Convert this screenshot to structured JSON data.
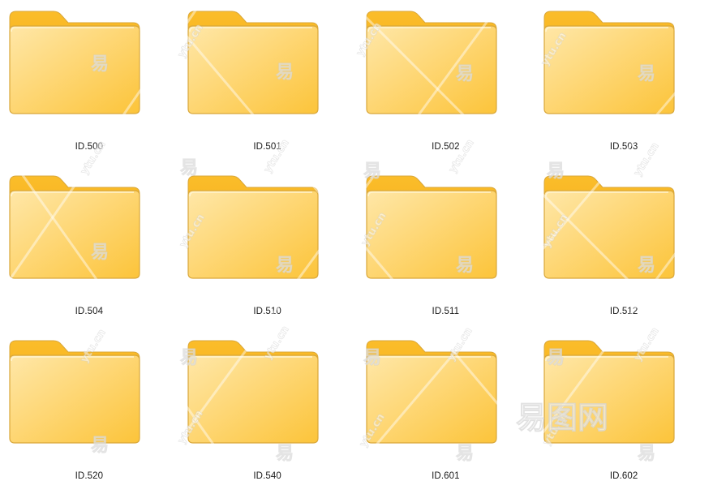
{
  "folders": [
    {
      "label": "ID.500",
      "icon": "folder-icon"
    },
    {
      "label": "ID.501",
      "icon": "folder-icon"
    },
    {
      "label": "ID.502",
      "icon": "folder-icon"
    },
    {
      "label": "ID.503",
      "icon": "folder-icon"
    },
    {
      "label": "ID.504",
      "icon": "folder-icon"
    },
    {
      "label": "ID.510",
      "icon": "folder-icon"
    },
    {
      "label": "ID.511",
      "icon": "folder-icon"
    },
    {
      "label": "ID.512",
      "icon": "folder-icon"
    },
    {
      "label": "ID.520",
      "icon": "folder-icon"
    },
    {
      "label": "ID.540",
      "icon": "folder-icon"
    },
    {
      "label": "ID.601",
      "icon": "folder-icon"
    },
    {
      "label": "ID.602",
      "icon": "folder-icon"
    }
  ],
  "watermark": {
    "mark": "易",
    "site": "ytu.cn",
    "brand": "易图网"
  },
  "colors": {
    "folder_front_light": "#ffe7a8",
    "folder_front_dark": "#fcc43a",
    "folder_back": "#f6b21f",
    "folder_border": "#d9a73a",
    "paper": "#f5f5f2",
    "label": "#1a1a1a"
  }
}
